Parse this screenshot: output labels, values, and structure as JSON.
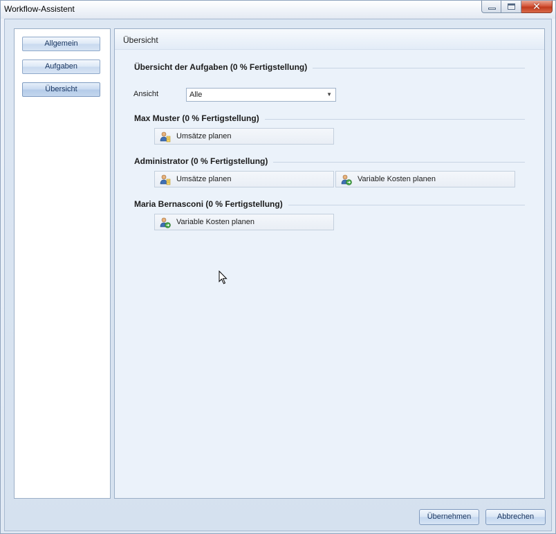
{
  "window": {
    "title": "Workflow-Assistent",
    "close_symbol": "✕"
  },
  "nav": {
    "items": [
      {
        "label": "Allgemein"
      },
      {
        "label": "Aufgaben"
      },
      {
        "label": "Übersicht",
        "active": true
      }
    ]
  },
  "main": {
    "header": "Übersicht",
    "overview_title": "Übersicht der Aufgaben (0 % Fertigstellung)",
    "view_label": "Ansicht",
    "view_value": "Alle",
    "groups": [
      {
        "title": "Max Muster (0 % Fertigstellung)",
        "tasks": [
          {
            "label": "Umsätze planen",
            "icon": "user-plan-icon"
          }
        ]
      },
      {
        "title": "Administrator (0 % Fertigstellung)",
        "tasks": [
          {
            "label": "Umsätze planen",
            "icon": "user-plan-icon"
          },
          {
            "label": "Variable Kosten planen",
            "icon": "user-go-icon"
          }
        ]
      },
      {
        "title": "Maria Bernasconi (0 % Fertigstellung)",
        "tasks": [
          {
            "label": "Variable Kosten planen",
            "icon": "user-go-icon"
          }
        ]
      }
    ]
  },
  "footer": {
    "apply_label": "Übernehmen",
    "cancel_label": "Abbrechen"
  },
  "colors": {
    "panel_bg": "#ebf2fa",
    "frame_bg": "#dde7f3",
    "button_text": "#15325e"
  }
}
